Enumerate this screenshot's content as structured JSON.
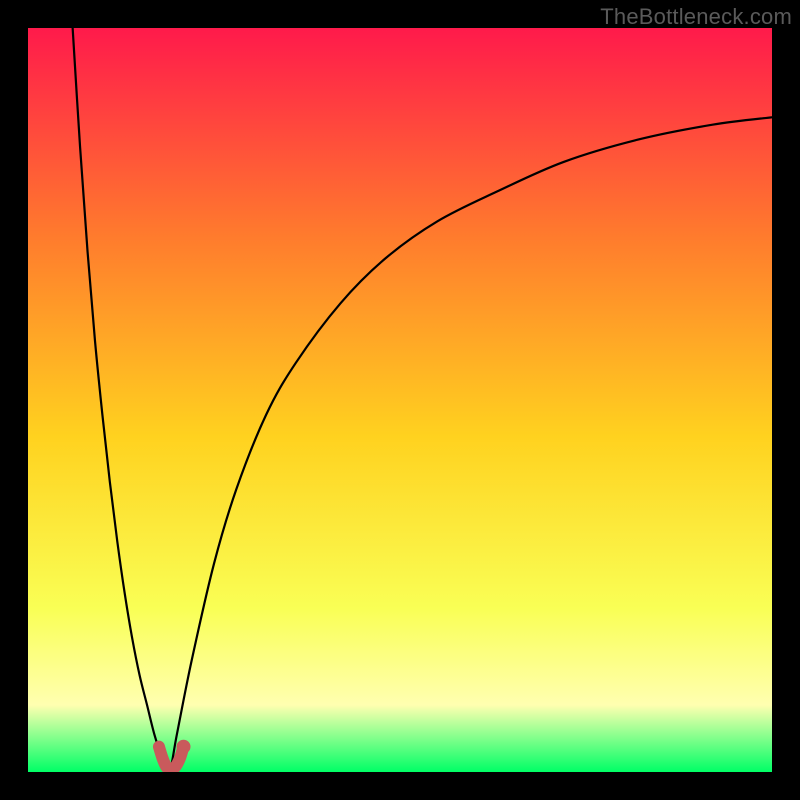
{
  "watermark": "TheBottleneck.com",
  "colors": {
    "frame": "#000000",
    "gradient_top": "#ff1a4b",
    "gradient_mid1": "#ff7b2d",
    "gradient_mid2": "#ffd21f",
    "gradient_mid3": "#f9ff55",
    "gradient_mid4": "#ffffb0",
    "gradient_bottom": "#00ff66",
    "curve": "#000000",
    "marker_fill": "#c95a5c",
    "marker_stroke": "#c95a5c"
  },
  "chart_data": {
    "type": "line",
    "title": "",
    "xlabel": "",
    "ylabel": "",
    "xlim": [
      0,
      100
    ],
    "ylim": [
      0,
      100
    ],
    "grid": false,
    "notch_x": 19,
    "series": [
      {
        "name": "left-branch",
        "x": [
          6,
          7,
          8,
          9,
          10,
          11,
          12,
          13,
          14,
          15,
          16,
          17,
          18,
          19
        ],
        "y": [
          100,
          84,
          70,
          58,
          48,
          39,
          31,
          24,
          18,
          13,
          9,
          5,
          2,
          0
        ]
      },
      {
        "name": "right-branch",
        "x": [
          19,
          20,
          22,
          25,
          28,
          32,
          36,
          42,
          48,
          55,
          63,
          72,
          82,
          92,
          100
        ],
        "y": [
          0,
          5,
          15,
          28,
          38,
          48,
          55,
          63,
          69,
          74,
          78,
          82,
          85,
          87,
          88
        ]
      }
    ],
    "marker": {
      "name": "u-marker",
      "x_range": [
        17.5,
        21
      ],
      "y_range": [
        0,
        3.5
      ],
      "points_x": [
        17.6,
        18.1,
        18.6,
        19.2,
        19.8,
        20.4,
        20.9
      ],
      "points_y": [
        3.4,
        1.8,
        0.7,
        0.3,
        0.7,
        1.8,
        3.4
      ]
    }
  }
}
